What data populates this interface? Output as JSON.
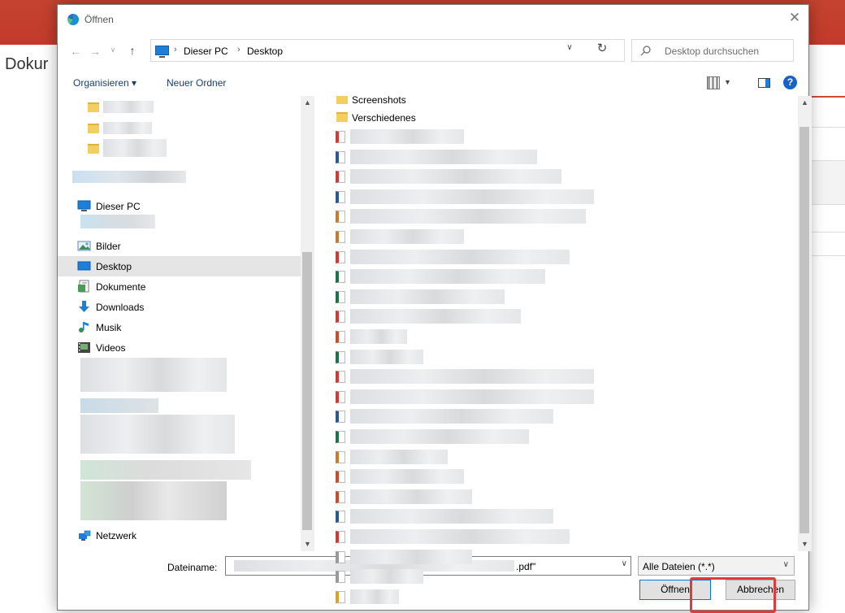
{
  "background": {
    "page_title_partial": "Dokur"
  },
  "dialog": {
    "title": "Öffnen",
    "breadcrumb": [
      "Dieser PC",
      "Desktop"
    ],
    "search_placeholder": "Desktop durchsuchen",
    "toolbar": {
      "organize": "Organisieren ▾",
      "new_folder": "Neuer Ordner",
      "help": "?"
    },
    "nav": {
      "this_pc": "Dieser PC",
      "items": [
        {
          "label": "Bilder",
          "icon": "pictures-icon"
        },
        {
          "label": "Desktop",
          "icon": "desktop-icon",
          "selected": true
        },
        {
          "label": "Dokumente",
          "icon": "documents-icon"
        },
        {
          "label": "Downloads",
          "icon": "downloads-icon"
        },
        {
          "label": "Musik",
          "icon": "music-icon"
        },
        {
          "label": "Videos",
          "icon": "videos-icon"
        }
      ],
      "network": "Netzwerk"
    },
    "files": {
      "partial_top": "Screenshots",
      "folder": "Verschiedenes"
    },
    "filename_label": "Dateiname:",
    "filename_value_suffix": ".pdf\"",
    "filetype": "Alle Dateien (*.*)",
    "open_button": "Öffnen",
    "cancel_button": "Abbrechen"
  }
}
